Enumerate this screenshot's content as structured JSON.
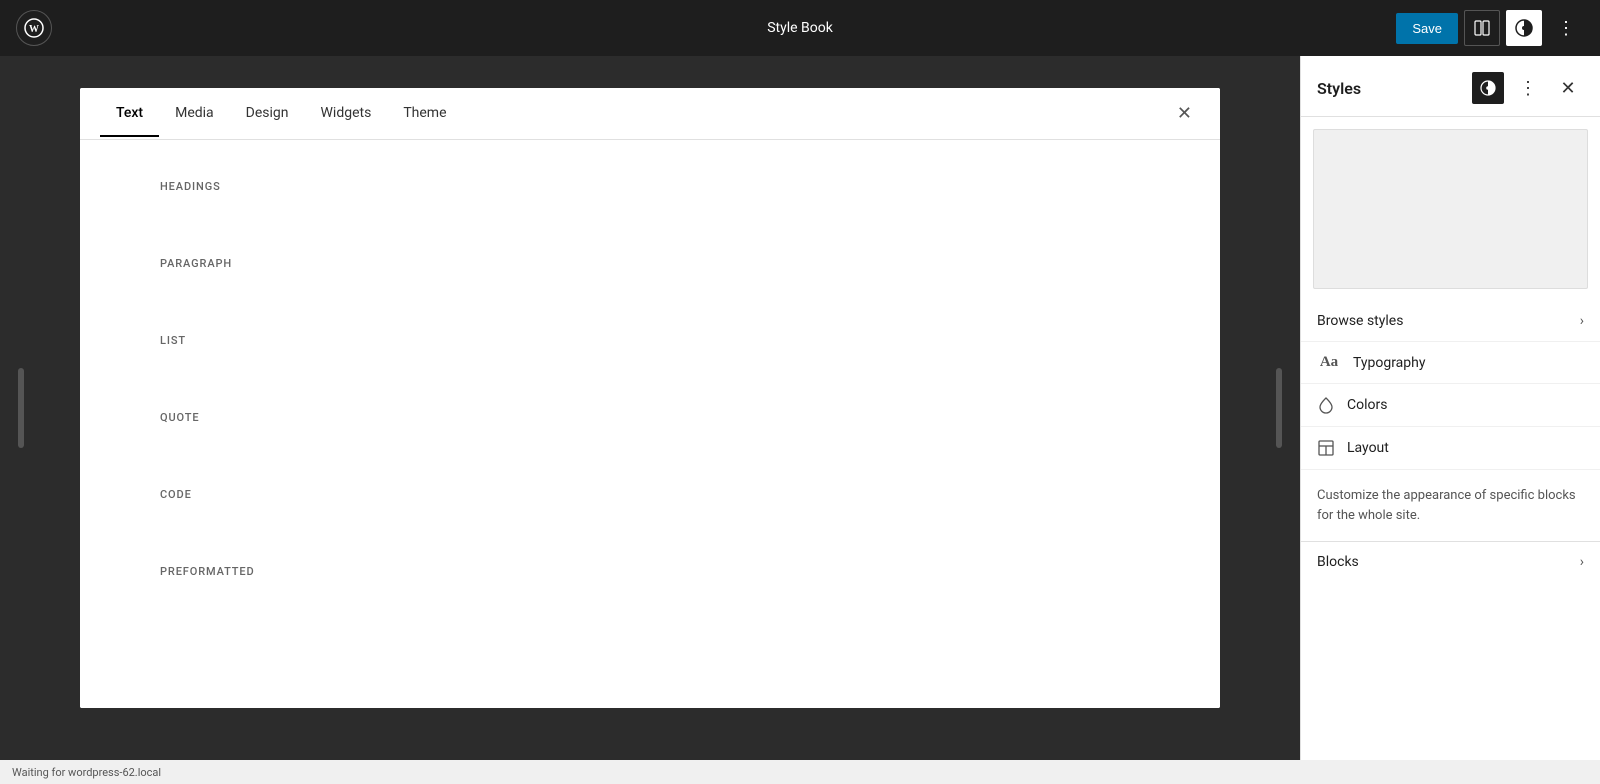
{
  "topbar": {
    "title": "Style Book",
    "save_label": "Save",
    "wp_logo_text": "W"
  },
  "tabs": {
    "items": [
      {
        "label": "Text",
        "active": true
      },
      {
        "label": "Media",
        "active": false
      },
      {
        "label": "Design",
        "active": false
      },
      {
        "label": "Widgets",
        "active": false
      },
      {
        "label": "Theme",
        "active": false
      }
    ]
  },
  "stylebook": {
    "sections": [
      {
        "label": "HEADINGS"
      },
      {
        "label": "PARAGRAPH"
      },
      {
        "label": "LIST"
      },
      {
        "label": "QUOTE"
      },
      {
        "label": "CODE"
      },
      {
        "label": "PREFORMATTED"
      }
    ]
  },
  "sidebar": {
    "title": "Styles",
    "browse_styles_label": "Browse styles",
    "typography_label": "Typography",
    "colors_label": "Colors",
    "layout_label": "Layout",
    "description": "Customize the appearance of specific blocks for the whole site.",
    "blocks_label": "Blocks"
  },
  "statusbar": {
    "text": "Waiting for wordpress-62.local"
  }
}
